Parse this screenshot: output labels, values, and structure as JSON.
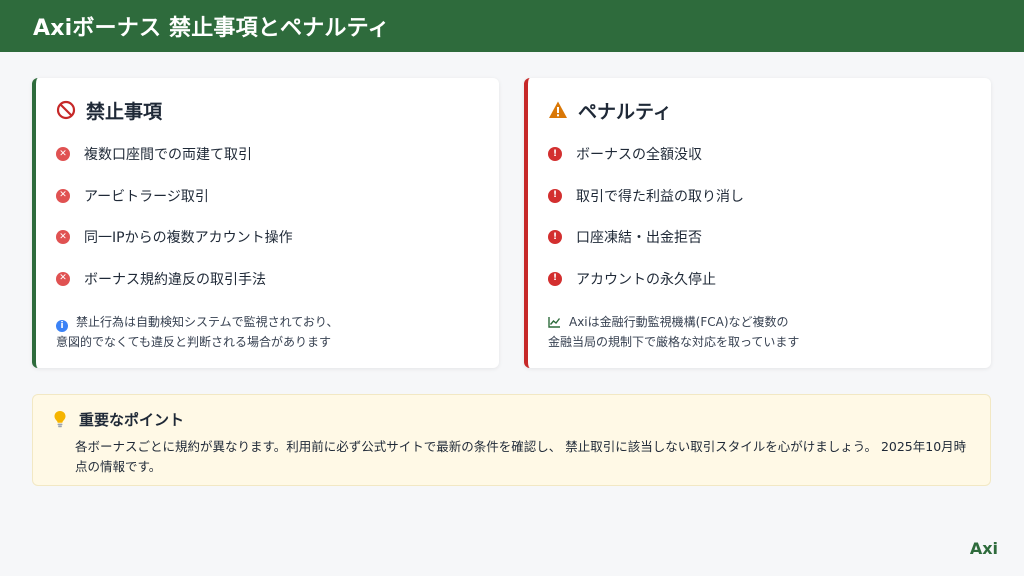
{
  "header": {
    "title": "Axiボーナス 禁止事項とペナルティ"
  },
  "prohibited": {
    "title": "禁止事項",
    "items": [
      "複数口座間での両建て取引",
      "アービトラージ取引",
      "同一IPからの複数アカウント操作",
      "ボーナス規約違反の取引手法"
    ],
    "note_line1": "禁止行為は自動検知システムで監視されており、",
    "note_line2": "意図的でなくても違反と判断される場合があります"
  },
  "penalty": {
    "title": "ペナルティ",
    "items": [
      "ボーナスの全額没収",
      "取引で得た利益の取り消し",
      "口座凍結・出金拒否",
      "アカウントの永久停止"
    ],
    "note_line1": "Axiは金融行動監視機構(FCA)など複数の",
    "note_line2": "金融当局の規制下で厳格な対応を取っています"
  },
  "key_point": {
    "title": "重要なポイント",
    "body": "各ボーナスごとに規約が異なります。利用前に必ず公式サイトで最新の条件を確認し、 禁止取引に該当しない取引スタイルを心がけましょう。 2025年10月時点の情報です。"
  },
  "logo": {
    "text": "Axi"
  },
  "colors": {
    "brand_green": "#2e6b3c",
    "danger_red": "#c62828",
    "warning_amber": "#d97706",
    "info_blue": "#3b82f6",
    "highlight_bg": "#fff9e6"
  },
  "icons": {
    "prohibited_title": "no-entry-icon",
    "penalty_title": "warning-triangle-icon",
    "prohibited_bullet": "x-circle-icon",
    "penalty_bullet": "exclamation-circle-icon",
    "prohibited_note": "info-circle-icon",
    "penalty_note": "chart-line-icon",
    "key_point": "lightbulb-icon"
  }
}
